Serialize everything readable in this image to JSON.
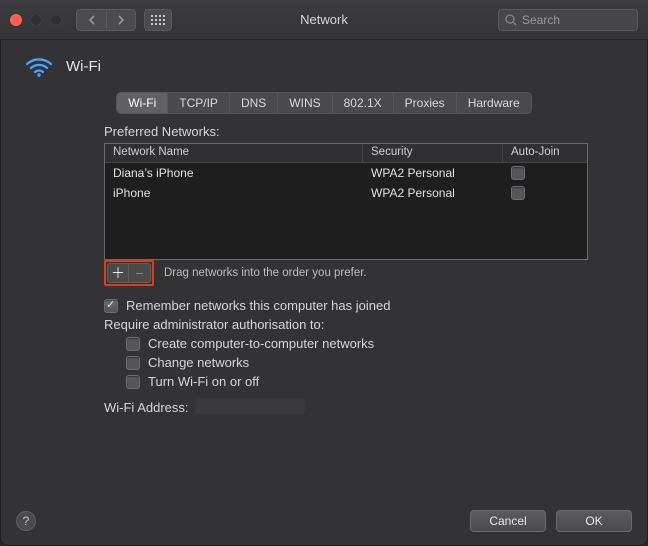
{
  "window": {
    "title": "Network"
  },
  "search": {
    "placeholder": "Search"
  },
  "header": {
    "title": "Wi-Fi"
  },
  "tabs": [
    "Wi-Fi",
    "TCP/IP",
    "DNS",
    "WINS",
    "802.1X",
    "Proxies",
    "Hardware"
  ],
  "active_tab": 0,
  "section": {
    "title": "Preferred Networks:"
  },
  "table": {
    "columns": [
      "Network Name",
      "Security",
      "Auto-Join"
    ],
    "rows": [
      {
        "name": "Diana’s iPhone",
        "security": "WPA2 Personal",
        "autojoin": false
      },
      {
        "name": "iPhone",
        "security": "WPA2 Personal",
        "autojoin": false
      }
    ]
  },
  "drag_hint": "Drag networks into the order you prefer.",
  "remember": {
    "label": "Remember networks this computer has joined",
    "checked": true
  },
  "admin_section_label": "Require administrator authorisation to:",
  "admin_opts": [
    {
      "label": "Create computer-to-computer networks",
      "checked": false
    },
    {
      "label": "Change networks",
      "checked": false
    },
    {
      "label": "Turn Wi-Fi on or off",
      "checked": false
    }
  ],
  "wifi_address_label": "Wi-Fi Address:",
  "buttons": {
    "cancel": "Cancel",
    "ok": "OK"
  }
}
